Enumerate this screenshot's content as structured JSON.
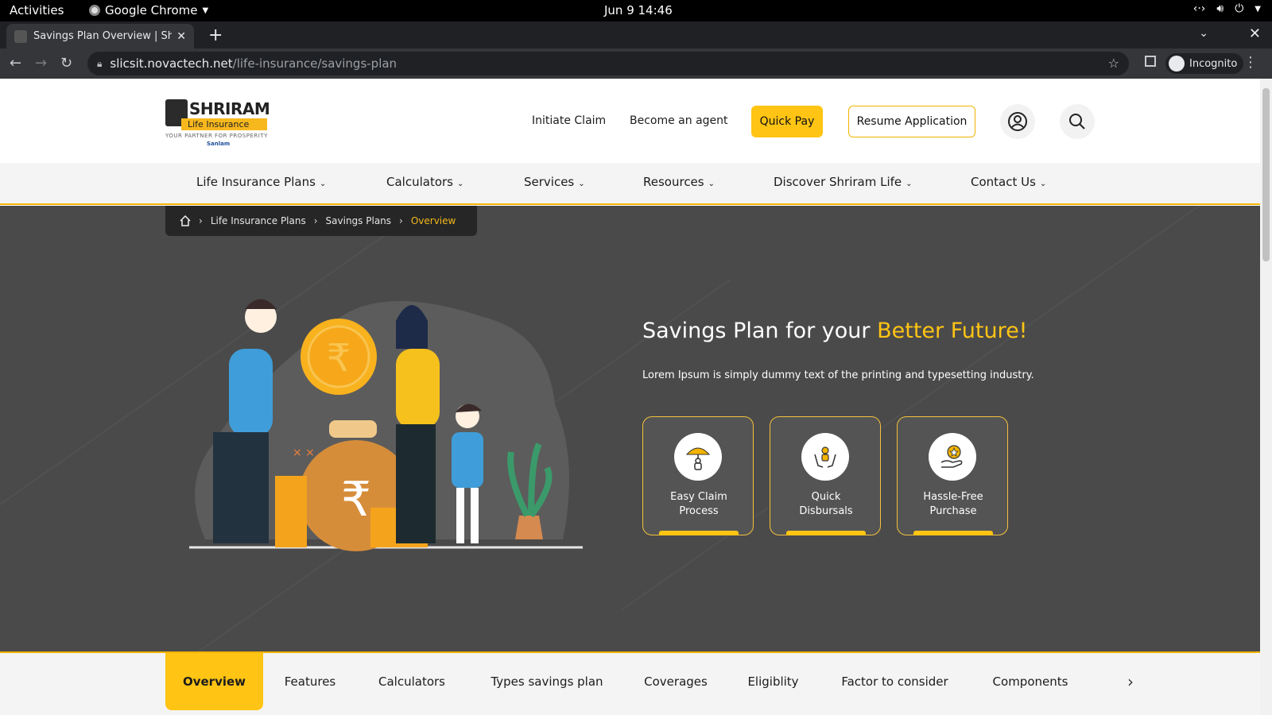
{
  "system": {
    "activities": "Activities",
    "app_name": "Google Chrome",
    "clock": "Jun 9  14:46"
  },
  "browser": {
    "tab_title": "Savings Plan Overview | Shrira",
    "url_host": "slicsit.novactech.net",
    "url_path": "/life-insurance/savings-plan",
    "profile_label": "Incognito"
  },
  "header": {
    "logo_brand": "SHRIRAM",
    "logo_sub": "Life Insurance",
    "logo_tagline": "YOUR PARTNER FOR PROSPERITY",
    "logo_sanlam": "Sanlam",
    "links": [
      "Initiate Claim",
      "Become an agent"
    ],
    "quick_pay": "Quick Pay",
    "resume": "Resume Application"
  },
  "nav": {
    "items": [
      "Life Insurance Plans",
      "Calculators",
      "Services",
      "Resources",
      "Discover Shriram Life",
      "Contact Us"
    ]
  },
  "breadcrumb": {
    "items": [
      "Life Insurance Plans",
      "Savings Plans",
      "Overview"
    ]
  },
  "hero": {
    "title_main": "Savings Plan for your ",
    "title_highlight": "Better Future!",
    "subtitle": "Lorem Ipsum is simply dummy text of the printing and typesetting industry.",
    "features": [
      {
        "line1": "Easy Claim",
        "line2": "Process",
        "icon": "umbrella-person-icon"
      },
      {
        "line1": "Quick",
        "line2": "Disbursals",
        "icon": "hands-person-icon"
      },
      {
        "line1": "Hassle-Free",
        "line2": "Purchase",
        "icon": "hand-star-icon"
      }
    ]
  },
  "section_tabs": {
    "items": [
      "Overview",
      "Features",
      "Calculators",
      "Types savings plan",
      "Coverages",
      "Eligiblity",
      "Factor to consider",
      "Components"
    ],
    "active": "Overview"
  },
  "colors": {
    "accent": "#ffc414",
    "hero_bg": "#4a4a4a",
    "nav_bg": "#f4f4f4"
  }
}
